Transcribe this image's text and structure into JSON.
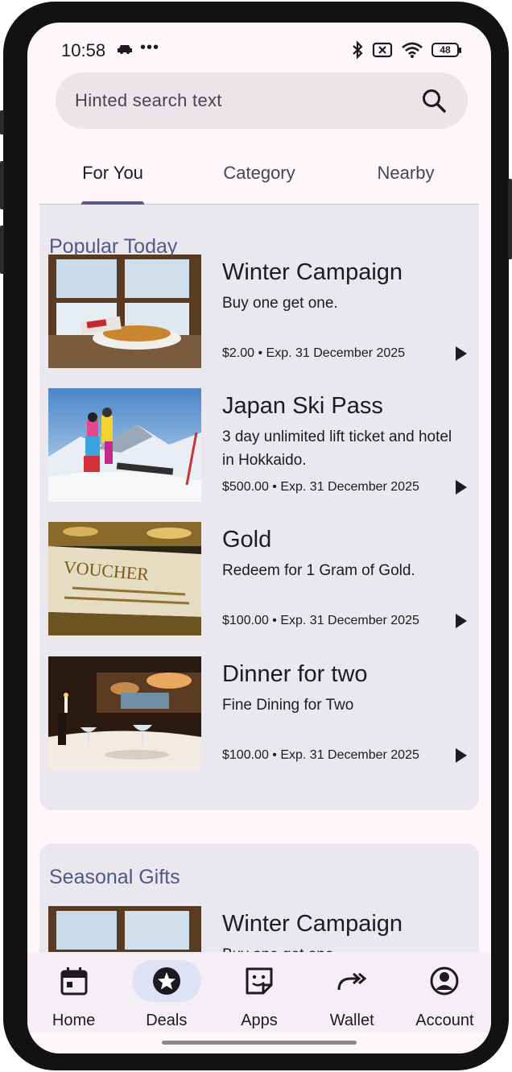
{
  "status_bar": {
    "time": "10:58",
    "more": "•••",
    "battery": "48"
  },
  "search": {
    "placeholder": "Hinted search text"
  },
  "tabs": [
    {
      "label": "For You",
      "active": true
    },
    {
      "label": "Category",
      "active": false
    },
    {
      "label": "Nearby",
      "active": false
    }
  ],
  "sections": [
    {
      "title": "Popular Today",
      "items": [
        {
          "title": "Winter Campaign",
          "description": "Buy one get one.",
          "price": "$2.00",
          "expiry": "Exp. 31 December 2025",
          "meta": "$2.00 • Exp. 31 December 2025",
          "image": "pastry-window-image"
        },
        {
          "title": "Japan Ski Pass",
          "description": "3 day unlimited lift ticket and hotel in Hokkaido.",
          "price": "$500.00",
          "expiry": "Exp. 31 December 2025",
          "meta": "$500.00 • Exp. 31 December 2025",
          "image": "skiers-mountain-image"
        },
        {
          "title": "Gold",
          "description": "Redeem for 1 Gram of Gold.",
          "price": "$100.00",
          "expiry": "Exp. 31 December 2025",
          "meta": "$100.00 • Exp. 31 December 2025",
          "image": "gold-voucher-image"
        },
        {
          "title": "Dinner for two",
          "description": "Fine Dining for Two",
          "price": "$100.00",
          "expiry": "Exp. 31 December 2025",
          "meta": "$100.00 • Exp. 31 December 2025",
          "image": "restaurant-table-image"
        }
      ]
    },
    {
      "title": "Seasonal Gifts",
      "items": [
        {
          "title": "Winter Campaign",
          "description": "Buy one get one.",
          "image": "pastry-window-image"
        }
      ]
    }
  ],
  "voucher_image_text": "VOUCHER",
  "bottom_nav": [
    {
      "label": "Home",
      "icon": "calendar-icon",
      "active": false
    },
    {
      "label": "Deals",
      "icon": "star-icon",
      "active": true
    },
    {
      "label": "Apps",
      "icon": "sticker-icon",
      "active": false
    },
    {
      "label": "Wallet",
      "icon": "forward-arrows-icon",
      "active": false
    },
    {
      "label": "Account",
      "icon": "account-circle-icon",
      "active": false
    }
  ],
  "colors": {
    "background": "#fdf7fc",
    "search_bg": "#ebe5ea",
    "section_bg": "#eae7ef",
    "section_title": "#4e5a85",
    "tab_indicator": "#5e5a8e",
    "nav_active_pill": "#dfe2f7",
    "nav_bg": "#f4eef5"
  }
}
